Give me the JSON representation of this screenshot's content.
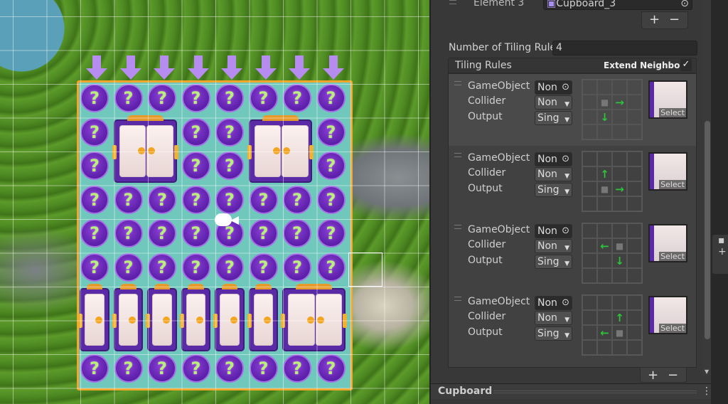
{
  "scene": {
    "arrow_columns": 8,
    "orb_glyph": "?",
    "board_rows": [
      "oooooooo",
      "o..oo..o",
      "o..oo..o",
      "oooooooo",
      "oooooooo",
      "oooooooo",
      "........",
      "........",
      "oooooooo"
    ],
    "cupboards": [
      {
        "col": 1,
        "row": 1,
        "span": 2
      },
      {
        "col": 5,
        "row": 1,
        "span": 2
      },
      {
        "col": 0,
        "row": 6,
        "span": 1
      },
      {
        "col": 1,
        "row": 6,
        "span": 1
      },
      {
        "col": 2,
        "row": 6,
        "span": 1
      },
      {
        "col": 3,
        "row": 6,
        "span": 1
      },
      {
        "col": 4,
        "row": 6,
        "span": 1
      },
      {
        "col": 5,
        "row": 6,
        "span": 1
      },
      {
        "col": 6,
        "row": 6,
        "span": 2
      }
    ]
  },
  "inspector": {
    "element3_label": "Element 3",
    "element3_value": "Cupboard_3",
    "add": "+",
    "remove": "−",
    "num_rules_label": "Number of Tiling Rule",
    "num_rules_value": "4",
    "tiling_rules_title": "Tiling Rules",
    "extend_neighbor_label": "Extend Neighbor",
    "extend_neighbor_checked": "✓",
    "rules": [
      {
        "gameobject_label": "GameObject",
        "gameobject_value": "Non",
        "collider_label": "Collider",
        "collider_value": "Non",
        "output_label": "Output",
        "output_value": "Sing",
        "select": "Select",
        "neighbors": [
          "",
          "",
          "",
          "",
          "",
          "c",
          "→",
          "",
          "",
          "↓",
          "",
          "",
          "",
          "",
          "",
          ""
        ]
      },
      {
        "gameobject_label": "GameObject",
        "gameobject_value": "Non",
        "collider_label": "Collider",
        "collider_value": "Non",
        "output_label": "Output",
        "output_value": "Sing",
        "select": "Select",
        "neighbors": [
          "",
          "",
          "",
          "",
          "",
          "↑",
          "",
          "",
          "",
          "c",
          "→",
          "",
          "",
          "",
          "",
          ""
        ]
      },
      {
        "gameobject_label": "GameObject",
        "gameobject_value": "Non",
        "collider_label": "Collider",
        "collider_value": "Non",
        "output_label": "Output",
        "output_value": "Sing",
        "select": "Select",
        "neighbors": [
          "",
          "",
          "",
          "",
          "",
          "←",
          "c",
          "",
          "",
          "",
          "↓",
          "",
          "",
          "",
          "",
          ""
        ]
      },
      {
        "gameobject_label": "GameObject",
        "gameobject_value": "Non",
        "collider_label": "Collider",
        "collider_value": "Non",
        "output_label": "Output",
        "output_value": "Sing",
        "select": "Select",
        "neighbors": [
          "",
          "",
          "",
          "",
          "",
          "",
          "↑",
          "",
          "",
          "←",
          "c",
          "",
          "",
          "",
          "",
          ""
        ]
      }
    ],
    "footer_add": "+",
    "footer_remove": "−",
    "cupboard_section": "Cupboard",
    "more_icon": "⋮"
  }
}
